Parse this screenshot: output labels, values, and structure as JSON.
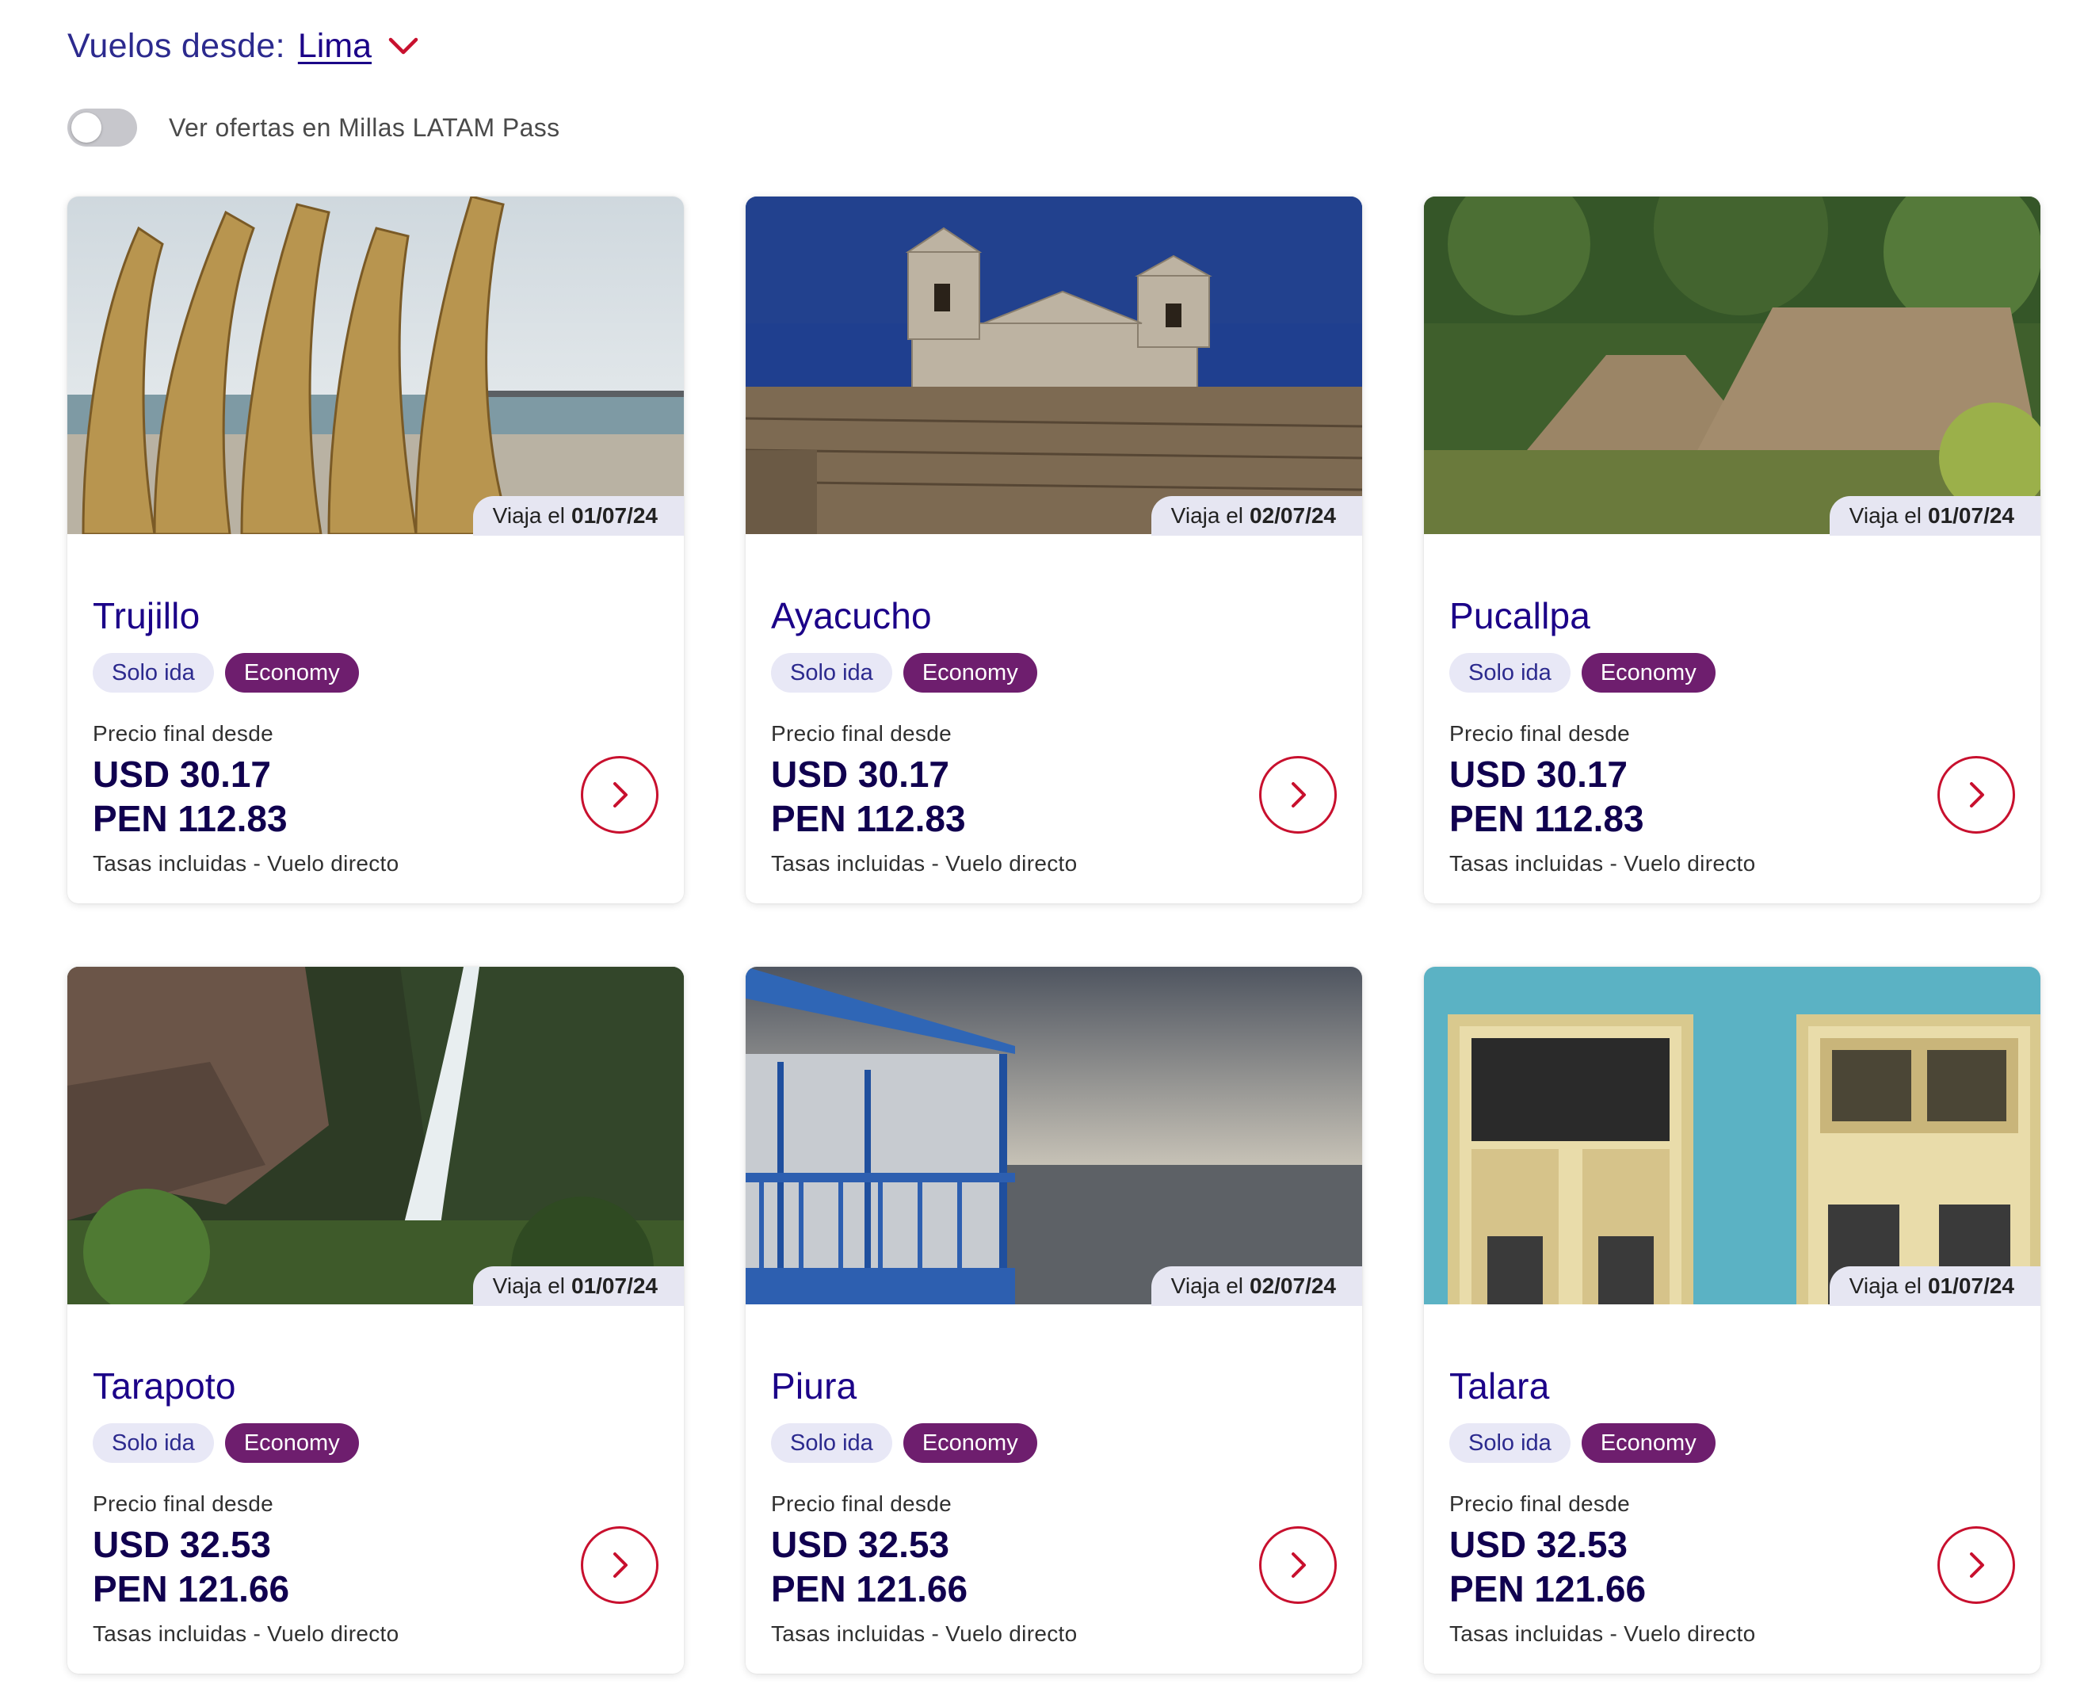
{
  "header": {
    "origin_label": "Vuelos desde:",
    "origin_city": "Lima",
    "miles_toggle_label": "Ver ofertas en Millas LATAM Pass",
    "miles_toggle_on": false
  },
  "colors": {
    "brand_blue": "#1b0088",
    "brand_red": "#c8102e",
    "economy_purple": "#6e1e6e"
  },
  "cards": [
    {
      "travel_prefix": "Viaja el",
      "date": "01/07/24",
      "city": "Trujillo",
      "trip_type": "Solo ida",
      "cabin": "Economy",
      "price_caption": "Precio final desde",
      "usd": "USD 30.17",
      "pen": "PEN 112.83",
      "footnote": "Tasas incluidas - Vuelo directo",
      "image": "reed-boats-beach"
    },
    {
      "travel_prefix": "Viaja el",
      "date": "02/07/24",
      "city": "Ayacucho",
      "trip_type": "Solo ida",
      "cabin": "Economy",
      "price_caption": "Precio final desde",
      "usd": "USD 30.17",
      "pen": "PEN 112.83",
      "footnote": "Tasas incluidas - Vuelo directo",
      "image": "stone-church"
    },
    {
      "travel_prefix": "Viaja el",
      "date": "01/07/24",
      "city": "Pucallpa",
      "trip_type": "Solo ida",
      "cabin": "Economy",
      "price_caption": "Precio final desde",
      "usd": "USD 30.17",
      "pen": "PEN 112.83",
      "footnote": "Tasas incluidas - Vuelo directo",
      "image": "thatched-huts"
    },
    {
      "travel_prefix": "Viaja el",
      "date": "01/07/24",
      "city": "Tarapoto",
      "trip_type": "Solo ida",
      "cabin": "Economy",
      "price_caption": "Precio final desde",
      "usd": "USD 32.53",
      "pen": "PEN 121.66",
      "footnote": "Tasas incluidas - Vuelo directo",
      "image": "waterfall"
    },
    {
      "travel_prefix": "Viaja el",
      "date": "02/07/24",
      "city": "Piura",
      "trip_type": "Solo ida",
      "cabin": "Economy",
      "price_caption": "Precio final desde",
      "usd": "USD 32.53",
      "pen": "PEN 121.66",
      "footnote": "Tasas incluidas - Vuelo directo",
      "image": "seaside-balcony"
    },
    {
      "travel_prefix": "Viaja el",
      "date": "01/07/24",
      "city": "Talara",
      "trip_type": "Solo ida",
      "cabin": "Economy",
      "price_caption": "Precio final desde",
      "usd": "USD 32.53",
      "pen": "PEN 121.66",
      "footnote": "Tasas incluidas - Vuelo directo",
      "image": "colonial-doors"
    }
  ]
}
